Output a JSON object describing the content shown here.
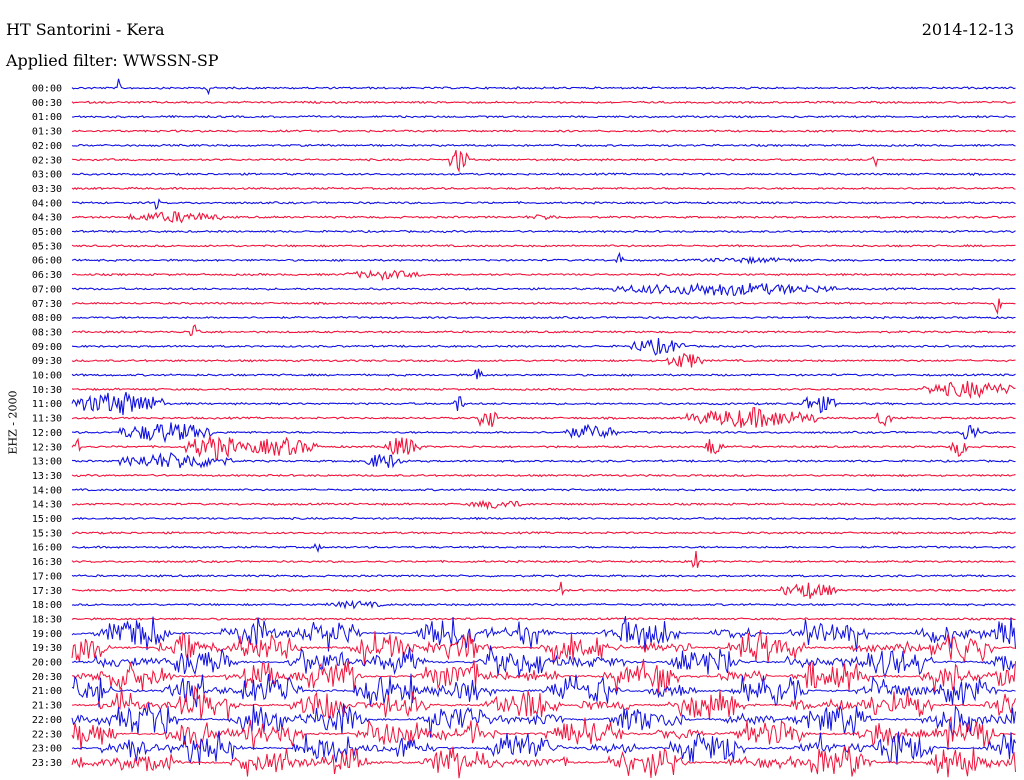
{
  "header": {
    "title": "HT Santorini - Kera",
    "date": "2014-12-13",
    "filter_label": "Applied filter: WWSSN-SP"
  },
  "chart_data": {
    "type": "line",
    "title": "HT Santorini - Kera",
    "ylabel": "EHZ - 2000",
    "colors": {
      "even_row": "#1010e0",
      "odd_row": "#f0143c"
    },
    "rows": [
      "00:00",
      "00:30",
      "01:00",
      "01:30",
      "02:00",
      "02:30",
      "03:00",
      "03:30",
      "04:00",
      "04:30",
      "05:00",
      "05:30",
      "06:00",
      "06:30",
      "07:00",
      "07:30",
      "08:00",
      "08:30",
      "09:00",
      "09:30",
      "10:00",
      "10:30",
      "11:00",
      "11:30",
      "12:00",
      "12:30",
      "13:00",
      "13:30",
      "14:00",
      "14:30",
      "15:00",
      "15:30",
      "16:00",
      "16:30",
      "17:00",
      "17:30",
      "18:00",
      "18:30",
      "19:00",
      "19:30",
      "20:00",
      "20:30",
      "21:00",
      "21:30",
      "22:00",
      "22:30",
      "23:00",
      "23:30"
    ],
    "events": [
      {
        "row": 0,
        "t": 0.05,
        "amp": 12,
        "dur": 0.002
      },
      {
        "row": 0,
        "t": 0.145,
        "amp": 10,
        "dur": 0.002
      },
      {
        "row": 5,
        "t": 0.41,
        "amp": 14,
        "dur": 0.01
      },
      {
        "row": 5,
        "t": 0.85,
        "amp": 10,
        "dur": 0.004
      },
      {
        "row": 8,
        "t": 0.09,
        "amp": 9,
        "dur": 0.003
      },
      {
        "row": 9,
        "t": 0.11,
        "amp": 6,
        "dur": 0.05
      },
      {
        "row": 9,
        "t": 0.5,
        "amp": 3,
        "dur": 0.02
      },
      {
        "row": 12,
        "t": 0.58,
        "amp": 7,
        "dur": 0.004
      },
      {
        "row": 12,
        "t": 0.72,
        "amp": 3,
        "dur": 0.06
      },
      {
        "row": 13,
        "t": 0.33,
        "amp": 5,
        "dur": 0.04
      },
      {
        "row": 14,
        "t": 0.69,
        "amp": 7,
        "dur": 0.12
      },
      {
        "row": 15,
        "t": 0.98,
        "amp": 12,
        "dur": 0.004
      },
      {
        "row": 17,
        "t": 0.13,
        "amp": 10,
        "dur": 0.006
      },
      {
        "row": 18,
        "t": 0.62,
        "amp": 9,
        "dur": 0.03
      },
      {
        "row": 19,
        "t": 0.65,
        "amp": 9,
        "dur": 0.02
      },
      {
        "row": 20,
        "t": 0.43,
        "amp": 12,
        "dur": 0.005
      },
      {
        "row": 21,
        "t": 0.95,
        "amp": 9,
        "dur": 0.05
      },
      {
        "row": 22,
        "t": 0.05,
        "amp": 13,
        "dur": 0.05
      },
      {
        "row": 22,
        "t": 0.41,
        "amp": 11,
        "dur": 0.005
      },
      {
        "row": 22,
        "t": 0.79,
        "amp": 10,
        "dur": 0.02
      },
      {
        "row": 23,
        "t": 0.44,
        "amp": 14,
        "dur": 0.01
      },
      {
        "row": 23,
        "t": 0.72,
        "amp": 11,
        "dur": 0.07
      },
      {
        "row": 23,
        "t": 0.86,
        "amp": 11,
        "dur": 0.008
      },
      {
        "row": 24,
        "t": 0.1,
        "amp": 11,
        "dur": 0.05
      },
      {
        "row": 24,
        "t": 0.55,
        "amp": 8,
        "dur": 0.03
      },
      {
        "row": 24,
        "t": 0.95,
        "amp": 11,
        "dur": 0.01
      },
      {
        "row": 25,
        "t": 0.0,
        "amp": 14,
        "dur": 0.01
      },
      {
        "row": 25,
        "t": 0.15,
        "amp": 14,
        "dur": 0.03
      },
      {
        "row": 25,
        "t": 0.22,
        "amp": 10,
        "dur": 0.04
      },
      {
        "row": 25,
        "t": 0.35,
        "amp": 11,
        "dur": 0.02
      },
      {
        "row": 25,
        "t": 0.68,
        "amp": 11,
        "dur": 0.01
      },
      {
        "row": 25,
        "t": 0.94,
        "amp": 10,
        "dur": 0.01
      },
      {
        "row": 26,
        "t": 0.11,
        "amp": 9,
        "dur": 0.06
      },
      {
        "row": 26,
        "t": 0.33,
        "amp": 9,
        "dur": 0.02
      },
      {
        "row": 29,
        "t": 0.45,
        "amp": 5,
        "dur": 0.03
      },
      {
        "row": 32,
        "t": 0.26,
        "amp": 5,
        "dur": 0.004
      },
      {
        "row": 33,
        "t": 0.66,
        "amp": 15,
        "dur": 0.003
      },
      {
        "row": 35,
        "t": 0.52,
        "amp": 15,
        "dur": 0.003
      },
      {
        "row": 35,
        "t": 0.78,
        "amp": 9,
        "dur": 0.03
      },
      {
        "row": 36,
        "t": 0.3,
        "amp": 4,
        "dur": 0.03
      }
    ],
    "storm_rows": [
      38,
      39,
      40,
      41,
      42,
      43,
      44,
      45,
      46,
      47
    ]
  }
}
